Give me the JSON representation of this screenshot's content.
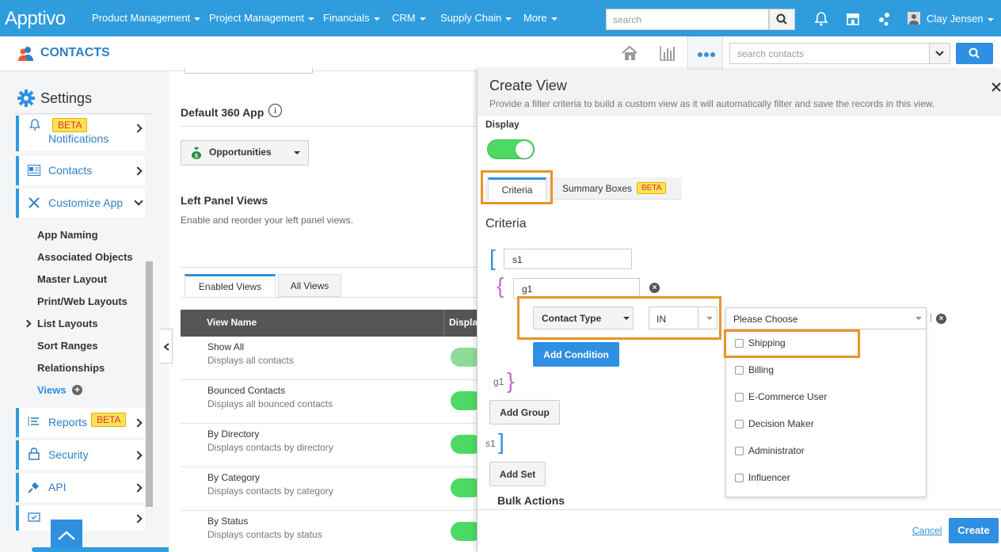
{
  "topnav": {
    "logo": "Apptivo",
    "items": [
      "Product Management",
      "Project Management",
      "Financials",
      "CRM",
      "Supply Chain",
      "More"
    ],
    "search_placeholder": "search",
    "user_name": "Clay Jensen"
  },
  "subheader": {
    "title": "CONTACTS",
    "search_placeholder": "search contacts"
  },
  "sidebar": {
    "title": "Settings",
    "notifications": {
      "label": "Notifications",
      "badge": "BETA"
    },
    "contacts": "Contacts",
    "customize_app": "Customize App",
    "sub_items": [
      "App Naming",
      "Associated Objects",
      "Master Layout",
      "Print/Web Layouts",
      "List Layouts",
      "Sort Ranges",
      "Relationships",
      "Views"
    ],
    "reports": {
      "label": "Reports",
      "badge": "BETA"
    },
    "security": "Security",
    "api": "API"
  },
  "main": {
    "default_360_title": "Default 360 App",
    "default_360_value": "Opportunities",
    "left_panel_title": "Left Panel Views",
    "left_panel_desc": "Enable and reorder your left panel views.",
    "tabs": [
      "Enabled Views",
      "All Views"
    ],
    "table_headers": [
      "View Name",
      "Displa"
    ],
    "rows": [
      {
        "name": "Show All",
        "desc": "Displays all contacts"
      },
      {
        "name": "Bounced Contacts",
        "desc": "Displays all bounced contacts"
      },
      {
        "name": "By Directory",
        "desc": "Displays contacts by directory"
      },
      {
        "name": "By Category",
        "desc": "Displays contacts by category"
      },
      {
        "name": "By Status",
        "desc": "Displays contacts by status"
      }
    ]
  },
  "panel": {
    "title": "Create View",
    "subtitle": "Provide a filter criteria to build a custom view as it will automatically filter and save the records in this view.",
    "display_label": "Display",
    "tabs": {
      "criteria": "Criteria",
      "summary": "Summary Boxes",
      "summary_badge": "BETA"
    },
    "criteria_heading": "Criteria",
    "set_value": "s1",
    "group_value": "g1",
    "field": "Contact Type",
    "operator": "IN",
    "value_placeholder": "Please Choose",
    "add_condition": "Add Condition",
    "group_close_label": "g1",
    "add_group": "Add Group",
    "set_close_label": "s1",
    "add_set": "Add Set",
    "bulk_actions": "Bulk Actions",
    "options": [
      "Shipping",
      "Billing",
      "E-Commerce User",
      "Decision Maker",
      "Administrator",
      "Influencer"
    ],
    "cancel": "Cancel",
    "create": "Create"
  }
}
